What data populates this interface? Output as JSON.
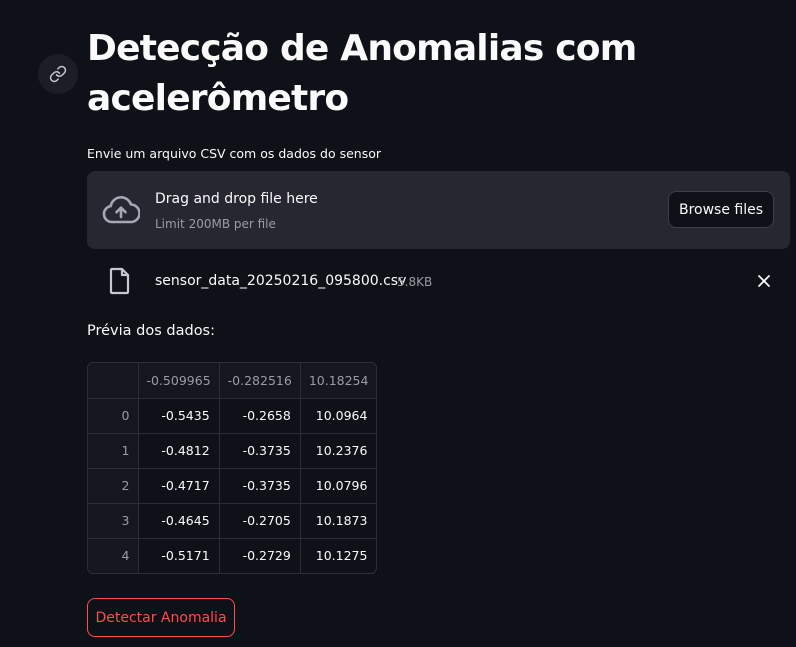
{
  "page": {
    "title": "Detecção de Anomalias com acelerômetro",
    "anchor_icon": "link-icon"
  },
  "uploader": {
    "label": "Envie um arquivo CSV com os dados do sensor",
    "dropzone_title": "Drag and drop file here",
    "dropzone_limit": "Limit 200MB per file",
    "browse_label": "Browse files",
    "icons": {
      "upload": "cloud-upload-icon",
      "file": "file-icon",
      "remove": "close-icon"
    }
  },
  "uploaded_file": {
    "name": "sensor_data_20250216_095800.csv",
    "size": "5.8KB"
  },
  "preview": {
    "label": "Prévia dos dados:",
    "columns": [
      "-0.509965",
      "-0.282516",
      "10.18254"
    ],
    "rows": [
      {
        "index": "0",
        "values": [
          "-0.5435",
          "-0.2658",
          "10.0964"
        ]
      },
      {
        "index": "1",
        "values": [
          "-0.4812",
          "-0.3735",
          "10.2376"
        ]
      },
      {
        "index": "2",
        "values": [
          "-0.4717",
          "-0.3735",
          "10.0796"
        ]
      },
      {
        "index": "3",
        "values": [
          "-0.4645",
          "-0.2705",
          "10.1873"
        ]
      },
      {
        "index": "4",
        "values": [
          "-0.5171",
          "-0.2729",
          "10.1275"
        ]
      }
    ]
  },
  "actions": {
    "detect_label": "Detectar Anomalia"
  },
  "colors": {
    "background": "#0e1117",
    "panel": "#262730",
    "accent": "#ff4b4b",
    "muted_text": "#9a9ca3"
  }
}
